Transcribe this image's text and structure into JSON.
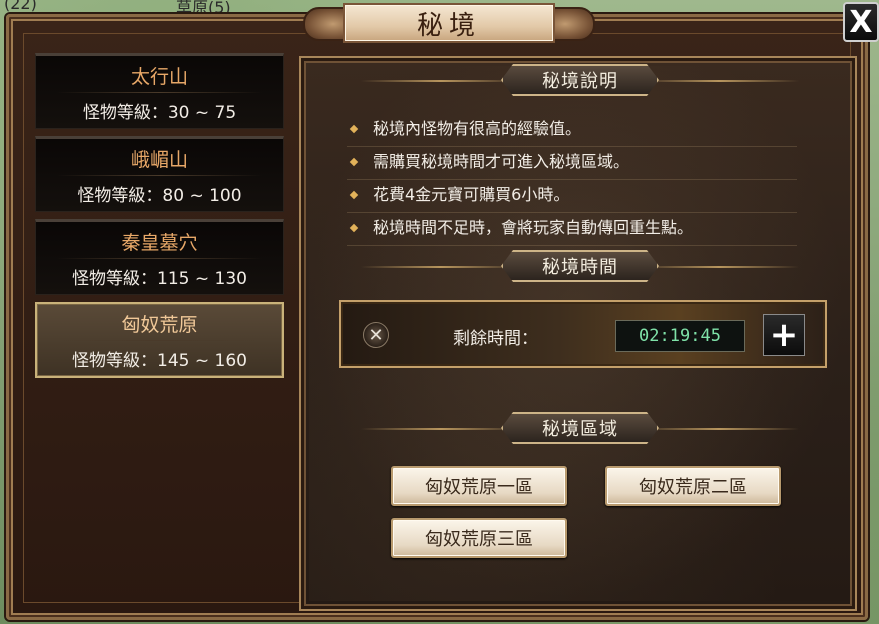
{
  "window": {
    "title": "秘境",
    "close_label": "X"
  },
  "background_map": {
    "top_left": "(22)",
    "top_mid": "草原(5)"
  },
  "map_list": [
    {
      "name": "太行山",
      "level": "怪物等級：30 ~ 75"
    },
    {
      "name": "峨嵋山",
      "level": "怪物等級：80 ~ 100"
    },
    {
      "name": "秦皇墓穴",
      "level": "怪物等級：115 ~ 130"
    },
    {
      "name": "匈奴荒原",
      "level": "怪物等級：145 ~ 160",
      "selected": true
    }
  ],
  "description": {
    "header": "秘境說明",
    "items": [
      "秘境內怪物有很高的經驗值。",
      "需購買秘境時間才可進入秘境區域。",
      "花費4金元寶可購買6小時。",
      "秘境時間不足時，會將玩家自動傳回重生點。"
    ]
  },
  "time": {
    "header": "秘境時間",
    "label": "剩餘時間：",
    "value": "02:19:45",
    "icon_name": "cancel-icon",
    "add_label": "+"
  },
  "zones": {
    "header": "秘境區域",
    "buttons": [
      "匈奴荒原一區",
      "匈奴荒原二區",
      "匈奴荒原三區"
    ]
  },
  "colors": {
    "list_name": "#e8a868",
    "timer_text": "#7fe2a8",
    "frame_gold": "#c4a06a"
  }
}
